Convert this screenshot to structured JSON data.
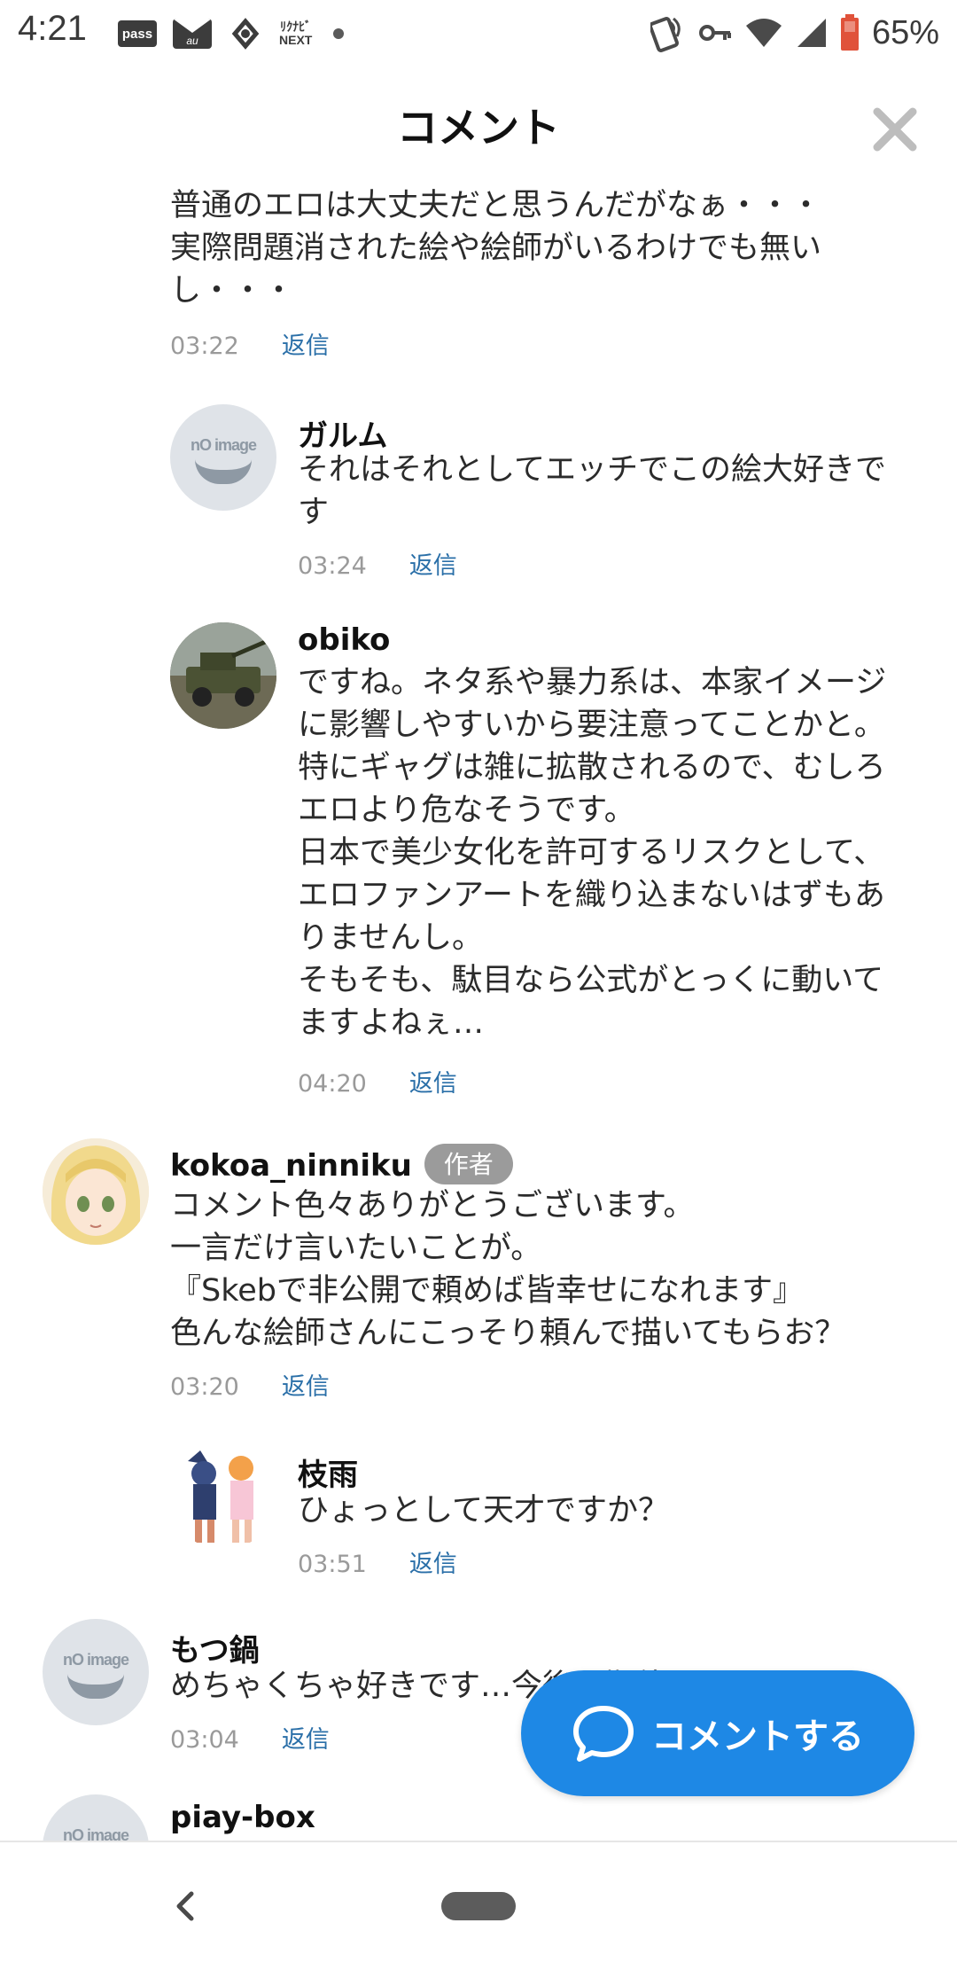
{
  "status_bar": {
    "time": "4:21",
    "pass_label": "pass",
    "mail_label": "au",
    "next_label_line1": "ﾘｸﾅﾋﾞ",
    "next_label_line2": "NEXT",
    "battery_percent": "65%",
    "icons": [
      "pass-icon",
      "au-mail-icon",
      "app-icon",
      "rikunabi-next-icon",
      "notification-dot-icon",
      "nfc-icon",
      "vpn-key-icon",
      "wifi-icon",
      "signal-icon",
      "battery-icon"
    ]
  },
  "header": {
    "title": "コメント",
    "close_icon": "close-icon"
  },
  "comments": [
    {
      "username": "",
      "body": "普通のエロは大丈夫だと思うんだがなぁ・・・\n実際問題消された絵や絵師がいるわけでも無い\nし・・・",
      "time": "03:22",
      "reply": "返信"
    },
    {
      "username": "ガルム",
      "body": "それはそれとしてエッチでこの絵大好きで\nす",
      "time": "03:24",
      "reply": "返信",
      "avatar": "no-image"
    },
    {
      "username": "obiko",
      "body": "ですね。ネタ系や暴力系は、本家イメージ\nに影響しやすいから要注意ってことかと。\n特にギャグは雑に拡散されるので、むしろ\nエロより危なそうです。\n日本で美少女化を許可するリスクとして、\nエロファンアートを織り込まないはずもあ\nりませんし。\nそもそも、駄目なら公式がとっくに動いて\nますよねぇ…",
      "time": "04:20",
      "reply": "返信",
      "avatar": "military-vehicle-photo"
    },
    {
      "username": "kokoa_ninniku",
      "badge": "作者",
      "body": "コメント色々ありがとうございます。\n一言だけ言いたいことが。\n『Skebで非公開で頼めば皆幸せになれます』\n色んな絵師さんにこっそり頼んで描いてもらお？",
      "time": "03:20",
      "reply": "返信",
      "avatar": "anime-girl-illustration"
    },
    {
      "username": "枝雨",
      "body": "ひょっとして天才ですか？",
      "time": "03:51",
      "reply": "返信",
      "avatar": "anime-duo-illustration"
    },
    {
      "username": "もつ鍋",
      "body": "めちゃくちゃ好きです…今後も期待してます",
      "time": "03:04",
      "reply": "返信",
      "avatar": "no-image"
    },
    {
      "username": "piay-box",
      "avatar": "no-image"
    }
  ],
  "no_image_text": "nO image",
  "fab": {
    "label": "コメントする",
    "icon": "chat-bubble-icon",
    "color": "#1e88e5"
  },
  "nav": {
    "back_icon": "back-chevron-icon",
    "home_icon": "home-pill-icon"
  },
  "colors": {
    "reply_link": "#2a6fa8",
    "badge": "#9b9b9b",
    "timestamp": "#9a9a9a"
  }
}
